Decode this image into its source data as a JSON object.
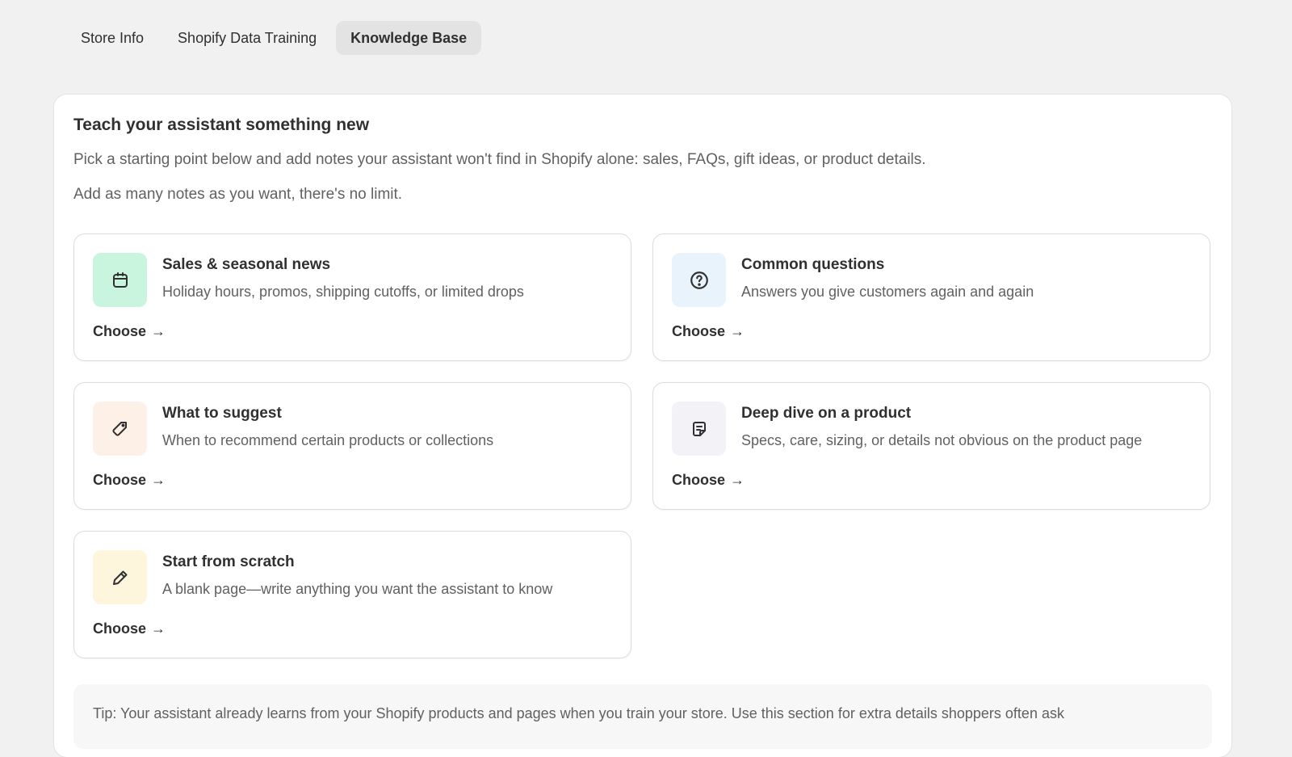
{
  "tabs": [
    {
      "label": "Store Info",
      "active": false
    },
    {
      "label": "Shopify Data Training",
      "active": false
    },
    {
      "label": "Knowledge Base",
      "active": true
    }
  ],
  "main": {
    "title": "Teach your assistant something new",
    "description_1": "Pick a starting point below and add notes your assistant won't find in Shopify alone: sales, FAQs, gift ideas, or product details.",
    "description_2": "Add as many notes as you want, there's no limit.",
    "options": [
      {
        "title": "Sales & seasonal news",
        "subtitle": "Holiday hours, promos, shipping cutoffs, or limited drops",
        "action": "Choose",
        "icon": "calendar-icon",
        "icon_bg": "#c9f5de"
      },
      {
        "title": "Common questions",
        "subtitle": "Answers you give customers again and again",
        "action": "Choose",
        "icon": "question-circle-icon",
        "icon_bg": "#e8f3fc"
      },
      {
        "title": "What to suggest",
        "subtitle": "When to recommend certain products or collections",
        "action": "Choose",
        "icon": "tag-icon",
        "icon_bg": "#fdf0e6"
      },
      {
        "title": "Deep dive on a product",
        "subtitle": "Specs, care, sizing, or details not obvious on the product page",
        "action": "Choose",
        "icon": "note-icon",
        "icon_bg": "#f3f2f7"
      },
      {
        "title": "Start from scratch",
        "subtitle": "A blank page—write anything you want the assistant to know",
        "action": "Choose",
        "icon": "pencil-icon",
        "icon_bg": "#fdf6dc"
      }
    ],
    "tip": "Tip: Your assistant already learns from your Shopify products and pages when you train your store. Use this section for extra details shoppers often ask"
  }
}
